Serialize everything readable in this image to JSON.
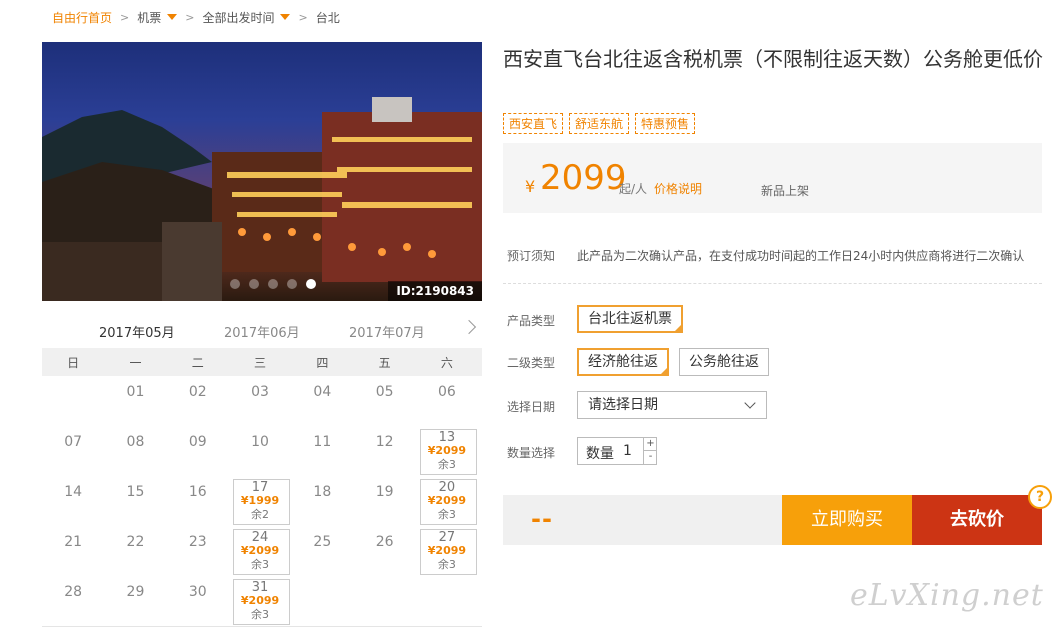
{
  "breadcrumb": {
    "home": "自由行首页",
    "items": [
      "机票",
      "全部出发时间",
      "台北"
    ]
  },
  "hero": {
    "id_label": "ID:2190843",
    "slides": 5,
    "active_slide": 4
  },
  "calendar": {
    "months": [
      "2017年05月",
      "2017年06月",
      "2017年07月"
    ],
    "active_month": 0,
    "weekdays": [
      "日",
      "一",
      "二",
      "三",
      "四",
      "五",
      "六"
    ],
    "weeks": [
      [
        {
          "d": ""
        },
        {
          "d": "01"
        },
        {
          "d": "02"
        },
        {
          "d": "03"
        },
        {
          "d": "04"
        },
        {
          "d": "05"
        },
        {
          "d": "06"
        }
      ],
      [
        {
          "d": "07"
        },
        {
          "d": "08"
        },
        {
          "d": "09"
        },
        {
          "d": "10"
        },
        {
          "d": "11"
        },
        {
          "d": "12"
        },
        {
          "d": "13",
          "p": "¥2099",
          "r": "余3"
        }
      ],
      [
        {
          "d": "14"
        },
        {
          "d": "15"
        },
        {
          "d": "16"
        },
        {
          "d": "17",
          "p": "¥1999",
          "r": "余2"
        },
        {
          "d": "18"
        },
        {
          "d": "19"
        },
        {
          "d": "20",
          "p": "¥2099",
          "r": "余3"
        }
      ],
      [
        {
          "d": "21"
        },
        {
          "d": "22"
        },
        {
          "d": "23"
        },
        {
          "d": "24",
          "p": "¥2099",
          "r": "余3"
        },
        {
          "d": "25"
        },
        {
          "d": "26"
        },
        {
          "d": "27",
          "p": "¥2099",
          "r": "余3"
        }
      ],
      [
        {
          "d": "28"
        },
        {
          "d": "29"
        },
        {
          "d": "30"
        },
        {
          "d": "31",
          "p": "¥2099",
          "r": "余3"
        },
        {
          "d": ""
        },
        {
          "d": ""
        },
        {
          "d": ""
        }
      ]
    ]
  },
  "product": {
    "title": "西安直飞台北往返含税机票（不限制往返天数）公务舱更低价",
    "tags": [
      "西安直飞",
      "舒适东航",
      "特惠预售"
    ],
    "price": {
      "currency": "¥",
      "amount": "2099",
      "per": "起/人",
      "explain": "价格说明",
      "new": "新品上架"
    },
    "notice_label": "预订须知",
    "notice_text": "此产品为二次确认产品，在支付成功时间起的工作日24小时内供应商将进行二次确认",
    "type_label": "产品类型",
    "type_options": [
      "台北往返机票"
    ],
    "subtype_label": "二级类型",
    "subtype_options": [
      "经济舱往返",
      "公务舱往返"
    ],
    "date_label": "选择日期",
    "date_placeholder": "请选择日期",
    "qty_label": "数量选择",
    "qty_field_label": "数量",
    "qty_value": "1",
    "qty_plus": "+",
    "qty_minus": "-",
    "summary_dash": "--",
    "buy_label": "立即购买",
    "bargain_label": "去砍价",
    "help_label": "?"
  },
  "watermark": "eLvXing.net",
  "colors": {
    "accent": "#f08300",
    "buy": "#f7a00a",
    "bargain": "#cc3414"
  }
}
